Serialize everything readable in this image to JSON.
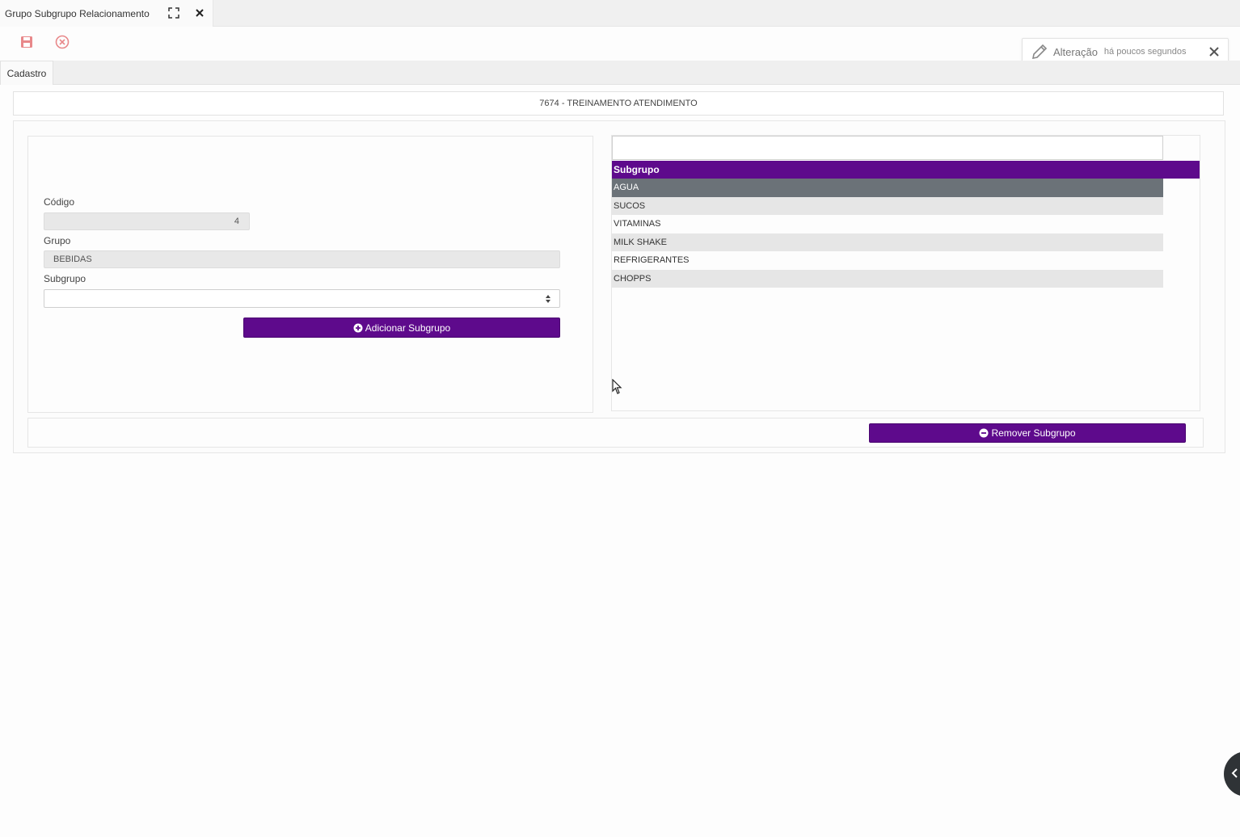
{
  "window_tab": {
    "title": "Grupo Subgrupo Relacionamento"
  },
  "notification": {
    "title": "Alteração",
    "time": "há poucos segundos"
  },
  "form_tabs": [
    {
      "label": "Cadastro"
    }
  ],
  "record": {
    "label": "7674 - TREINAMENTO ATENDIMENTO"
  },
  "form": {
    "codigo_label": "Código",
    "codigo_value": "4",
    "grupo_label": "Grupo",
    "grupo_value": "BEBIDAS",
    "subgrupo_label": "Subgrupo",
    "subgrupo_value": "",
    "add_button": "Adicionar Subgrupo"
  },
  "list": {
    "header": "Subgrupo",
    "filter_value": "",
    "items": [
      {
        "label": "AGUA",
        "selected": true
      },
      {
        "label": "SUCOS",
        "selected": false
      },
      {
        "label": "VITAMINAS",
        "selected": false
      },
      {
        "label": "MILK SHAKE",
        "selected": false
      },
      {
        "label": "REFRIGERANTES",
        "selected": false
      },
      {
        "label": "CHOPPS",
        "selected": false
      }
    ],
    "remove_button": "Remover Subgrupo"
  },
  "colors": {
    "accent_purple": "#5e0a8c",
    "selected_row": "#6b7278",
    "save_icon": "#e8888a",
    "cancel_icon": "#e8888a"
  },
  "icons": {
    "maximize": "maximize-icon",
    "close_tab": "close-icon",
    "save": "save-icon",
    "cancel": "cancel-circle-icon",
    "notification": "pencil-icon",
    "add": "plus-circle-icon",
    "remove": "minus-circle-icon"
  }
}
